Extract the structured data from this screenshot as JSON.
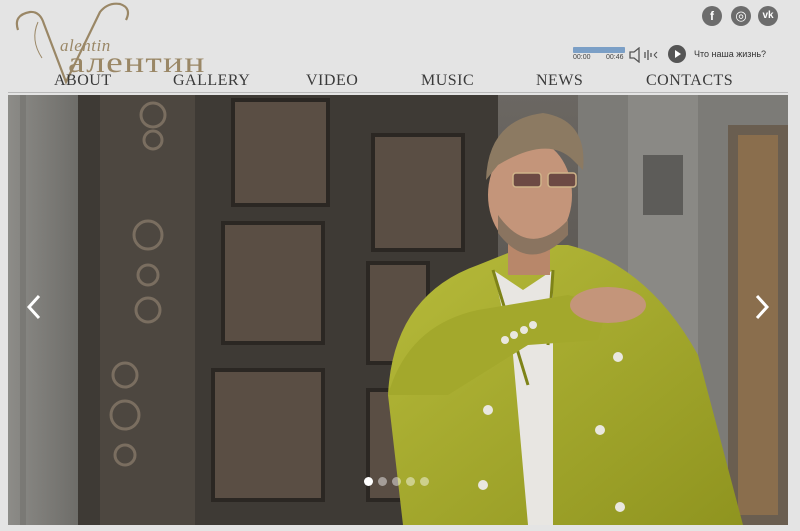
{
  "logo": {
    "script_text": "alentin",
    "cyrillic_text": "алентин"
  },
  "nav": {
    "items": [
      {
        "label": "ABOUT"
      },
      {
        "label": "GALLERY"
      },
      {
        "label": "VIDEO"
      },
      {
        "label": "MUSIC"
      },
      {
        "label": "NEWS"
      },
      {
        "label": "CONTACTS"
      }
    ]
  },
  "social": [
    {
      "icon": "facebook-icon",
      "glyph": "f"
    },
    {
      "icon": "instagram-icon",
      "glyph": "◎"
    },
    {
      "icon": "vk-icon",
      "glyph": "vk"
    }
  ],
  "player": {
    "current_time": "00:00",
    "duration": "00:46",
    "progress": 1.0,
    "track_title": "Что наша жизнь?"
  },
  "slider": {
    "slide_count": 5,
    "active_slide": 1,
    "prev_icon": "chevron-left-icon",
    "next_icon": "chevron-right-icon"
  },
  "colors": {
    "logo": "#9a8766",
    "nav_text": "#3a3a3a",
    "social_bg": "#6c6c6c",
    "jacket": "#a7ad2f"
  }
}
